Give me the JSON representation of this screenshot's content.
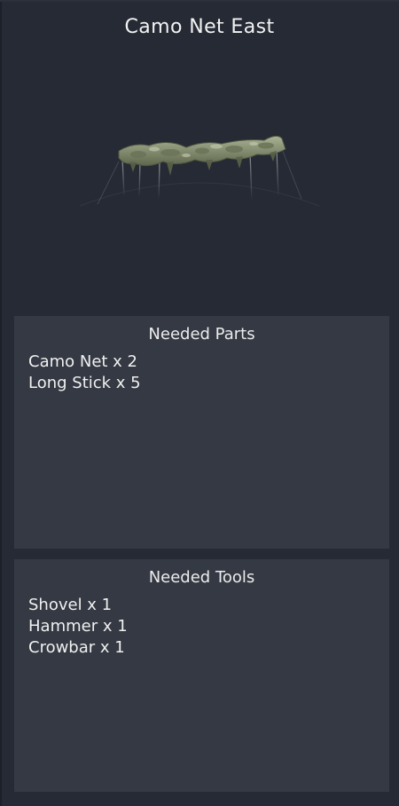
{
  "title": "Camo Net East",
  "preview": {
    "icon": "camo-net-model",
    "net_color": "#8c9778",
    "pole_color": "#9aa0a6"
  },
  "parts": {
    "heading": "Needed Parts",
    "items": [
      "Camo Net x 2",
      "Long Stick x 5"
    ]
  },
  "tools": {
    "heading": "Needed Tools",
    "items": [
      "Shovel x 1",
      "Hammer x 1",
      "Crowbar x 1"
    ]
  },
  "colors": {
    "background": "#252a34",
    "section_bg": "#343943",
    "text": "#f0f0f0"
  }
}
